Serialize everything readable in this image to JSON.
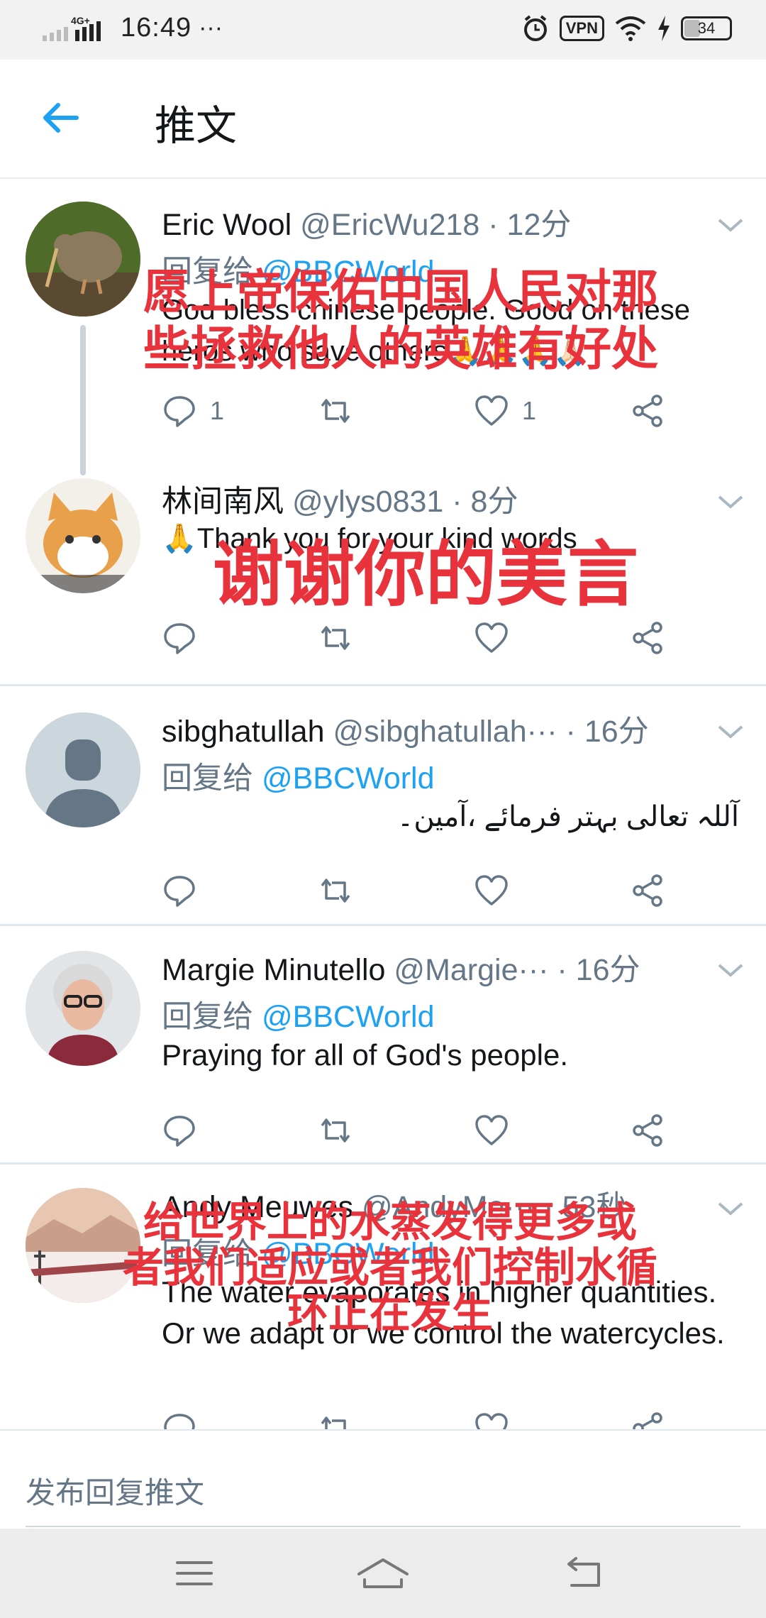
{
  "status_bar": {
    "network": "4G+",
    "time": "16:49",
    "more": "···",
    "vpn": "VPN",
    "battery": "34"
  },
  "header": {
    "title": "推文"
  },
  "tweets": [
    {
      "name": "Eric Wool",
      "handle": "@EricWu218",
      "time": "· 12分",
      "reply_prefix": "回复给",
      "reply_to": "@BBCWorld",
      "text": "God bless chinese people. Good on these heros who save others🙏🙏🙏🙏🏻",
      "reply_count": "1",
      "like_count": "1"
    },
    {
      "name": "林间南风",
      "handle": "@ylys0831",
      "time": "· 8分",
      "text": "🙏Thank you for your kind words",
      "reply_count": "",
      "like_count": ""
    },
    {
      "name": "sibghatullah",
      "handle": "@sibghatullah···",
      "time": "· 16分",
      "reply_prefix": "回复给",
      "reply_to": "@BBCWorld",
      "text": "آللہ تعالی بہتر فرمائے ،آمین۔",
      "reply_count": "",
      "like_count": ""
    },
    {
      "name": "Margie Minutello",
      "handle": "@Margie···",
      "time": "· 16分",
      "reply_prefix": "回复给",
      "reply_to": "@BBCWorld",
      "text": "Praying for all of God's people.",
      "reply_count": "",
      "like_count": ""
    },
    {
      "name": "Andy Meuwes",
      "handle": "@AndyMe···",
      "time": "· 53秒",
      "reply_prefix": "回复给",
      "reply_to": "@BBCWorld",
      "text": "The water evaporates in higher quantities. Or we adapt or we control the watercycles.",
      "reply_count": "",
      "like_count": ""
    }
  ],
  "overlays": {
    "caption1_line1": "愿上帝保佑中国人民对那",
    "caption1_line2": "些拯救他人的英雄有好处",
    "caption2": "谢谢你的美言",
    "caption3_line1": "给世界上的水蒸发得更多或",
    "caption3_line2": "者我们适应或者我们控制水循",
    "caption3_line3": "环正在发生"
  },
  "composer": {
    "placeholder": "发布回复推文"
  },
  "colors": {
    "accent": "#1da1f2",
    "secondary_text": "#657786",
    "overlay_red": "#e8323c"
  }
}
